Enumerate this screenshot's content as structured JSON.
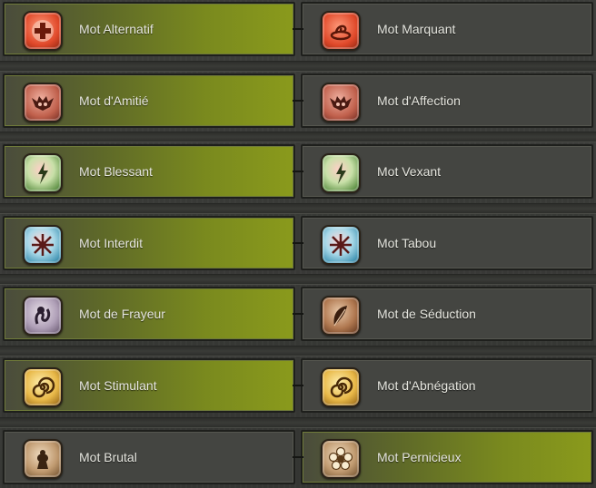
{
  "rows": [
    {
      "left": {
        "label": "Mot Alternatif",
        "icon": "cross-icon",
        "color": "red",
        "active": true
      },
      "right": {
        "label": "Mot Marquant",
        "icon": "swirl-icon",
        "color": "red",
        "active": false
      }
    },
    {
      "left": {
        "label": "Mot d'Amitié",
        "icon": "bat-icon",
        "color": "mauve",
        "active": true
      },
      "right": {
        "label": "Mot d'Affection",
        "icon": "bat-icon",
        "color": "mauve",
        "active": false
      }
    },
    {
      "left": {
        "label": "Mot Blessant",
        "icon": "bolt-icon",
        "color": "green",
        "active": true
      },
      "right": {
        "label": "Mot Vexant",
        "icon": "bolt-icon",
        "color": "green",
        "active": false
      }
    },
    {
      "left": {
        "label": "Mot Interdit",
        "icon": "snowflake-icon",
        "color": "blue",
        "active": true
      },
      "right": {
        "label": "Mot Tabou",
        "icon": "snowflake-icon",
        "color": "blue",
        "active": false
      }
    },
    {
      "left": {
        "label": "Mot de Frayeur",
        "icon": "tentacle-icon",
        "color": "purple",
        "active": true
      },
      "right": {
        "label": "Mot de Séduction",
        "icon": "feather-icon",
        "color": "brown",
        "active": false
      }
    },
    {
      "left": {
        "label": "Mot Stimulant",
        "icon": "spiral-icon",
        "color": "gold",
        "active": true
      },
      "right": {
        "label": "Mot d'Abnégation",
        "icon": "spiral-icon",
        "color": "gold",
        "active": false
      }
    },
    {
      "left": {
        "label": "Mot Brutal",
        "icon": "bird-icon",
        "color": "tan",
        "active": false
      },
      "right": {
        "label": "Mot Pernicieux",
        "icon": "flower-icon",
        "color": "tan",
        "active": true
      }
    }
  ]
}
